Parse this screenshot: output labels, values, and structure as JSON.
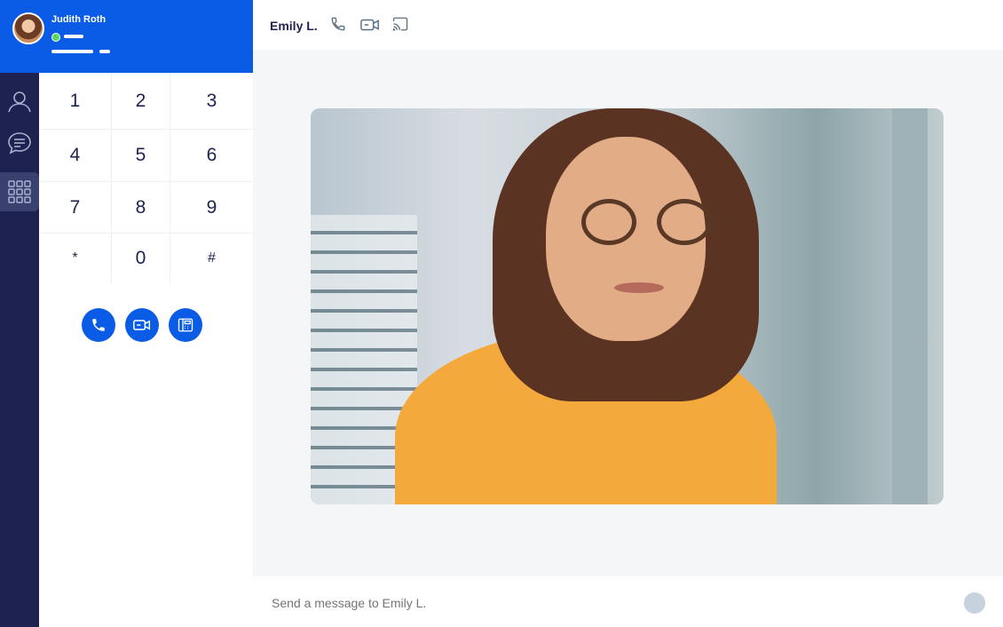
{
  "profile": {
    "name": "Judith Roth"
  },
  "contact": {
    "name": "Emily L."
  },
  "dialpad": {
    "keys": [
      "1",
      "2",
      "3",
      "4",
      "5",
      "6",
      "7",
      "8",
      "9",
      "*",
      "0",
      "#"
    ]
  },
  "composer": {
    "placeholder": "Send a message to Emily L."
  },
  "colors": {
    "brand": "#0a5ce6",
    "rail": "#1e2250",
    "stage": "#f5f6f8"
  },
  "icons": {
    "rail": [
      "contacts-icon",
      "chat-icon",
      "dialpad-icon"
    ],
    "actions": [
      "phone-icon",
      "video-call-icon",
      "fax-icon"
    ],
    "topbar": [
      "phone-icon",
      "video-call-icon",
      "cast-icon"
    ]
  }
}
